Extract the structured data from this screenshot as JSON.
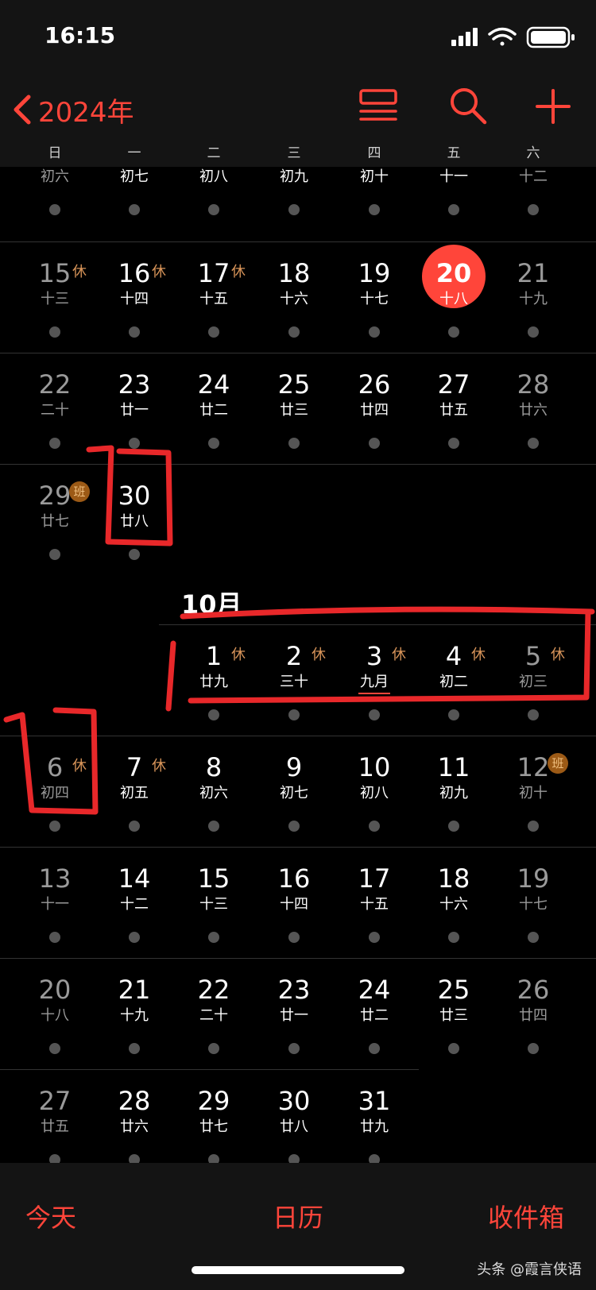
{
  "status_bar": {
    "time": "16:15"
  },
  "nav": {
    "back_label": "2024年"
  },
  "weekdays": [
    "日",
    "一",
    "二",
    "三",
    "四",
    "五",
    "六"
  ],
  "cut_row": {
    "lunar": [
      "初六",
      "初七",
      "初八",
      "初九",
      "初十",
      "十一",
      "十二"
    ]
  },
  "september_rows": [
    [
      {
        "d": "15",
        "l": "十三",
        "tag": "休"
      },
      {
        "d": "16",
        "l": "十四",
        "tag": "休"
      },
      {
        "d": "17",
        "l": "十五",
        "tag": "休"
      },
      {
        "d": "18",
        "l": "十六"
      },
      {
        "d": "19",
        "l": "十七"
      },
      {
        "d": "20",
        "l": "十八",
        "today": true
      },
      {
        "d": "21",
        "l": "十九"
      }
    ],
    [
      {
        "d": "22",
        "l": "二十"
      },
      {
        "d": "23",
        "l": "廿一"
      },
      {
        "d": "24",
        "l": "廿二"
      },
      {
        "d": "25",
        "l": "廿三"
      },
      {
        "d": "26",
        "l": "廿四"
      },
      {
        "d": "27",
        "l": "廿五"
      },
      {
        "d": "28",
        "l": "廿六"
      }
    ],
    [
      {
        "d": "29",
        "l": "廿七",
        "tag": "班"
      },
      {
        "d": "30",
        "l": "廿八"
      }
    ]
  ],
  "october": {
    "title": "10月",
    "rows": [
      [
        null,
        null,
        {
          "d": "1",
          "l": "廿九",
          "tag": "休"
        },
        {
          "d": "2",
          "l": "三十",
          "tag": "休"
        },
        {
          "d": "3",
          "l": "九月",
          "tag": "休",
          "underline": true
        },
        {
          "d": "4",
          "l": "初二",
          "tag": "休"
        },
        {
          "d": "5",
          "l": "初三",
          "tag": "休"
        }
      ],
      [
        {
          "d": "6",
          "l": "初四",
          "tag": "休"
        },
        {
          "d": "7",
          "l": "初五",
          "tag": "休"
        },
        {
          "d": "8",
          "l": "初六"
        },
        {
          "d": "9",
          "l": "初七"
        },
        {
          "d": "10",
          "l": "初八"
        },
        {
          "d": "11",
          "l": "初九"
        },
        {
          "d": "12",
          "l": "初十",
          "tag": "班"
        }
      ],
      [
        {
          "d": "13",
          "l": "十一"
        },
        {
          "d": "14",
          "l": "十二"
        },
        {
          "d": "15",
          "l": "十三"
        },
        {
          "d": "16",
          "l": "十四"
        },
        {
          "d": "17",
          "l": "十五"
        },
        {
          "d": "18",
          "l": "十六"
        },
        {
          "d": "19",
          "l": "十七"
        }
      ],
      [
        {
          "d": "20",
          "l": "十八"
        },
        {
          "d": "21",
          "l": "十九"
        },
        {
          "d": "22",
          "l": "二十"
        },
        {
          "d": "23",
          "l": "廿一"
        },
        {
          "d": "24",
          "l": "廿二"
        },
        {
          "d": "25",
          "l": "廿三"
        },
        {
          "d": "26",
          "l": "廿四"
        }
      ],
      [
        {
          "d": "27",
          "l": "廿五"
        },
        {
          "d": "28",
          "l": "廿六"
        },
        {
          "d": "29",
          "l": "廿七"
        },
        {
          "d": "30",
          "l": "廿八"
        },
        {
          "d": "31",
          "l": "廿九"
        }
      ]
    ]
  },
  "tabs": {
    "today": "今天",
    "calendars": "日历",
    "inbox": "收件箱"
  },
  "watermark": "头条 @霞言侠语",
  "colors": {
    "accent": "#ff453a",
    "holiday_tag": "#d9955a",
    "work_badge": "#9c5a16",
    "annotation": "#e8282a"
  }
}
